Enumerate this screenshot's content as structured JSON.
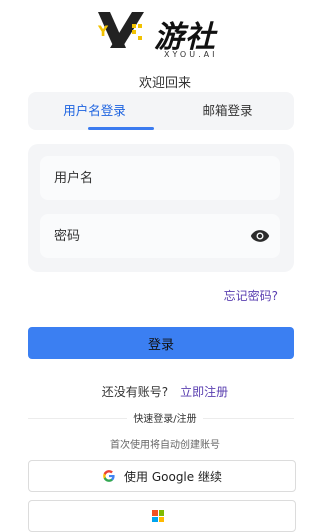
{
  "logo": {
    "text": "游社",
    "sub": "XYOU.AI",
    "mark_letters": "Y"
  },
  "welcome": "欢迎回来",
  "tabs": [
    {
      "label": "用户名登录",
      "active": true
    },
    {
      "label": "邮箱登录",
      "active": false
    }
  ],
  "form": {
    "username_placeholder": "用户名",
    "password_placeholder": "密码"
  },
  "forgot_label": "忘记密码?",
  "login_label": "登录",
  "register": {
    "prompt": "还没有账号?",
    "link": "立即注册"
  },
  "quick_label": "快速登录/注册",
  "auto_note": "首次使用将自动创建账号",
  "google_label": "使用 Google 继续",
  "colors": {
    "accent": "#3b7ff2",
    "link": "#5a3fb0",
    "tab_active": "#1d63e0"
  }
}
